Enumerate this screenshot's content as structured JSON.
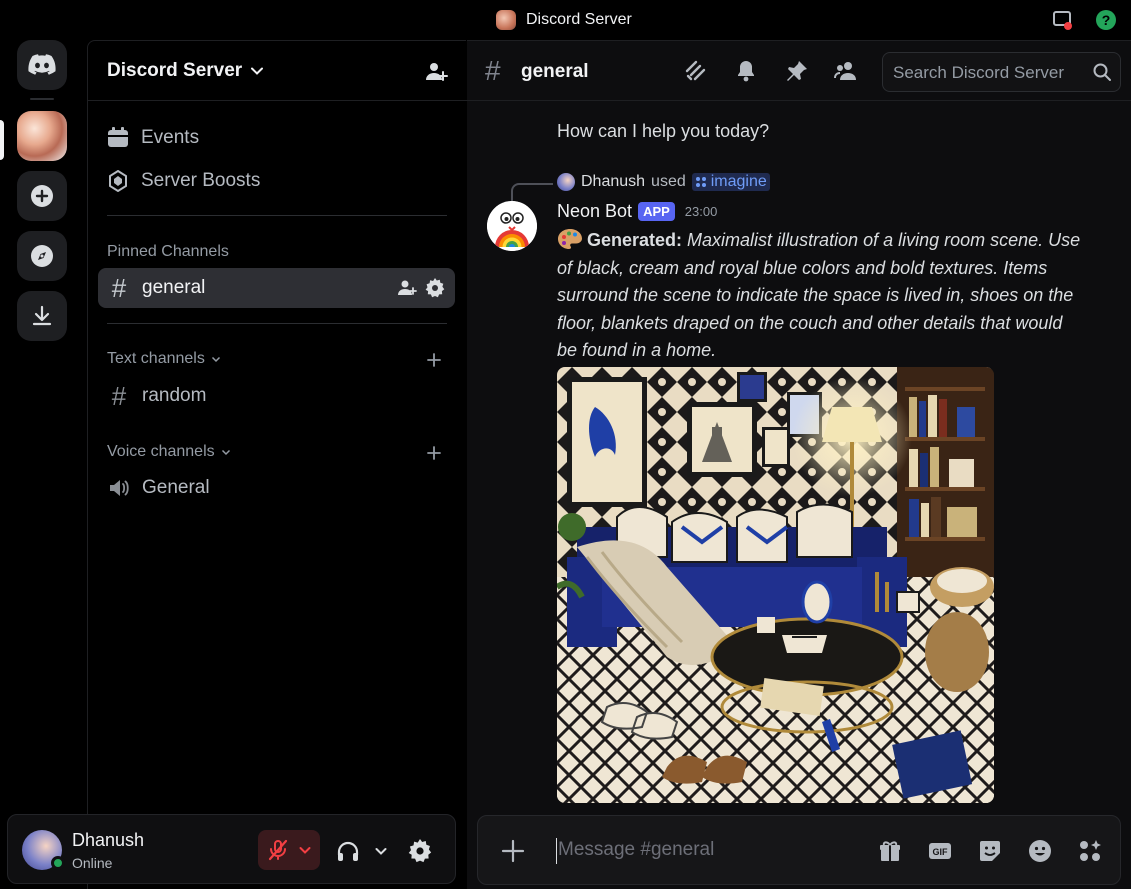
{
  "window": {
    "title": "Discord Server"
  },
  "server": {
    "name": "Discord Server"
  },
  "sidebar": {
    "events_label": "Events",
    "boosts_label": "Server Boosts",
    "pinned_label": "Pinned Channels",
    "pinned_channel": "general",
    "text_label": "Text channels",
    "text_channel": "random",
    "voice_label": "Voice channels",
    "voice_channel": "General"
  },
  "user": {
    "name": "Dhanush",
    "status": "Online"
  },
  "chat": {
    "channel": "general",
    "search_placeholder": "Search Discord Server",
    "prev_message": "How can I help you today?",
    "reply": {
      "user": "Dhanush",
      "verb": "used",
      "command": "imagine"
    },
    "message": {
      "author": "Neon Bot",
      "tag": "APP",
      "time": "23:00",
      "label": "Generated:",
      "text": "Maximalist illustration of a living room scene. Use of black, cream and royal blue colors and bold textures. Items surround the scene to indicate the space is lived in, shoes on the floor, blankets draped on the couch and other details that would be found in a home."
    },
    "composer_placeholder": "Message #general"
  },
  "colors": {
    "accent": "#5865f2",
    "online": "#23a55a",
    "muted_red": "#f23f43",
    "command_link": "#6f9cf7"
  }
}
